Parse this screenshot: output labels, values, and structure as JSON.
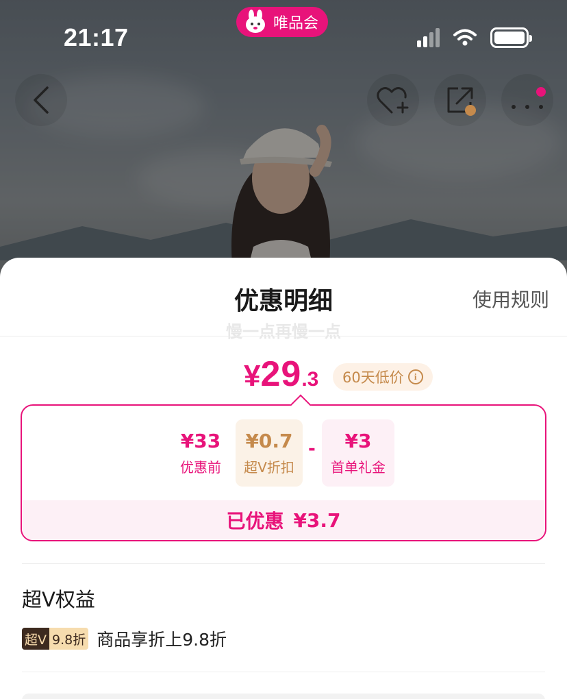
{
  "status_bar": {
    "time": "21:17",
    "app_name": "唯品会"
  },
  "hero": {
    "back_icon": "chevron-left-icon",
    "favorite_icon": "heart-plus-icon",
    "share_icon": "share-icon",
    "more_icon": "more-dots-icon"
  },
  "sheet": {
    "title": "优惠明细",
    "rules_label": "使用规则",
    "ghost_caption": "慢一点再慢一点",
    "final_price": {
      "symbol": "¥",
      "integer": "29",
      "decimal": ".3"
    },
    "low_price_badge": "60天低价",
    "breakdown": {
      "items": [
        {
          "amount": "¥33",
          "label": "优惠前"
        },
        {
          "amount": "¥0.7",
          "label": "超V折扣"
        },
        {
          "amount": "¥3",
          "label": "首单礼金"
        }
      ],
      "minus": "-",
      "saved_label": "已优惠",
      "saved_amount": "¥3.7"
    },
    "benefits": {
      "section_title": "超V权益",
      "tag_left": "超V",
      "tag_right": "9.8折",
      "description": "商品享折上9.8折"
    }
  },
  "colors": {
    "brand": "#e8137a",
    "gold": "#c58a4c"
  }
}
